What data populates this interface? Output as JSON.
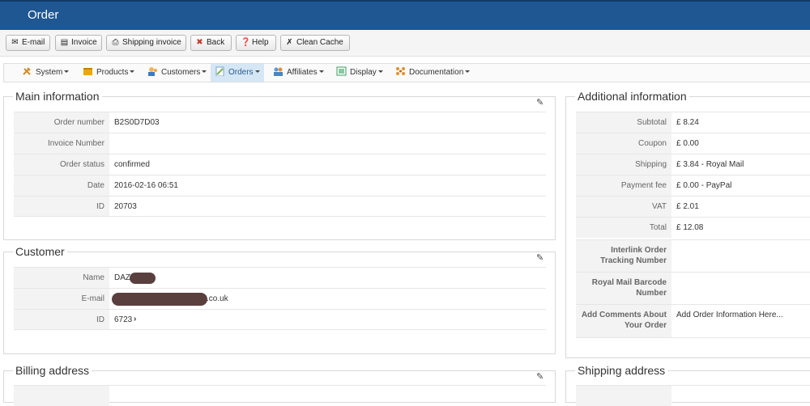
{
  "header": {
    "title": "Order"
  },
  "toolbar": {
    "email": "E-mail",
    "invoice": "Invoice",
    "shipping_invoice": "Shipping invoice",
    "back": "Back",
    "help": "Help",
    "clean_cache": "Clean Cache"
  },
  "menu": {
    "items": [
      {
        "label": "System"
      },
      {
        "label": "Products"
      },
      {
        "label": "Customers"
      },
      {
        "label": "Orders"
      },
      {
        "label": "Affiliates"
      },
      {
        "label": "Display"
      },
      {
        "label": "Documentation"
      }
    ]
  },
  "main_info": {
    "legend": "Main information",
    "rows": [
      {
        "label": "Order number",
        "value": "B2S0D7D03"
      },
      {
        "label": "Invoice Number",
        "value": ""
      },
      {
        "label": "Order status",
        "value": "confirmed"
      },
      {
        "label": "Date",
        "value": "2016-02-16 06:51"
      },
      {
        "label": "ID",
        "value": "20703"
      }
    ]
  },
  "customer": {
    "legend": "Customer",
    "rows": [
      {
        "label": "Name",
        "value": "DAZ"
      },
      {
        "label": "E-mail",
        "value": ".co.uk"
      },
      {
        "label": "ID",
        "value": "6723"
      }
    ]
  },
  "billing": {
    "legend": "Billing address"
  },
  "additional": {
    "legend": "Additional information",
    "rows": [
      {
        "label": "Subtotal",
        "value": "£ 8.24"
      },
      {
        "label": "Coupon",
        "value": "£ 0.00"
      },
      {
        "label": "Shipping",
        "value": "£ 3.84 - Royal Mail"
      },
      {
        "label": "Payment fee",
        "value": "£ 0.00 - PayPal"
      },
      {
        "label": "VAT",
        "value": "£ 2.01"
      },
      {
        "label": "Total",
        "value": "£ 12.08"
      },
      {
        "label": "Interlink Order Tracking Number",
        "value": ""
      },
      {
        "label": "Royal Mail Barcode Number",
        "value": ""
      },
      {
        "label": "Add Comments About Your Order",
        "value": "Add Order Information Here..."
      }
    ]
  },
  "shipping_address": {
    "legend": "Shipping address"
  },
  "colors": {
    "header_bg": "#1f5792",
    "active_menu_bg": "#d5e6f4"
  },
  "icons": [
    "envelope-icon",
    "invoice-icon",
    "printer-icon",
    "back-icon",
    "help-icon",
    "clean-cache-icon",
    "pencil-icon",
    "chevron-right-icon"
  ]
}
